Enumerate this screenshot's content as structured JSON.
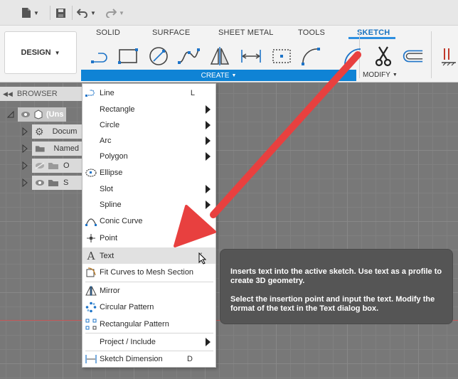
{
  "quick_access": {
    "items": [
      "file-icon",
      "save-icon",
      "undo-icon",
      "redo-icon"
    ]
  },
  "ribbon": {
    "workspace_label": "DESIGN",
    "tabs": [
      {
        "label": "SOLID"
      },
      {
        "label": "SURFACE"
      },
      {
        "label": "SHEET METAL"
      },
      {
        "label": "TOOLS"
      },
      {
        "label": "SKETCH"
      }
    ],
    "create_label": "CREATE",
    "modify_label": "MODIFY"
  },
  "browser": {
    "title": "BROWSER",
    "rows": [
      {
        "label": "(Uns"
      },
      {
        "label": "Docum"
      },
      {
        "label": "Named"
      },
      {
        "label": "O"
      },
      {
        "label": "S"
      }
    ]
  },
  "menu": {
    "items": [
      {
        "label": "Line",
        "shortcut": "L"
      },
      {
        "label": "Rectangle"
      },
      {
        "label": "Circle"
      },
      {
        "label": "Arc"
      },
      {
        "label": "Polygon"
      },
      {
        "label": "Ellipse"
      },
      {
        "label": "Slot"
      },
      {
        "label": "Spline"
      },
      {
        "label": "Conic Curve"
      },
      {
        "label": "Point"
      },
      {
        "label": "Text"
      },
      {
        "label": "Fit Curves to Mesh Section"
      },
      {
        "label": "Mirror"
      },
      {
        "label": "Circular Pattern"
      },
      {
        "label": "Rectangular Pattern"
      },
      {
        "label": "Project / Include"
      },
      {
        "label": "Sketch Dimension",
        "shortcut": "D"
      }
    ]
  },
  "tooltip": {
    "paragraph1": "Inserts text into the active sketch. Use text as a profile to create 3D geometry.",
    "paragraph2": "Select the insertion point and input the text. Modify the format of the text in the Text dialog box."
  },
  "colors": {
    "accent": "#0f83d5",
    "annotation_arrow": "#e8403f"
  }
}
